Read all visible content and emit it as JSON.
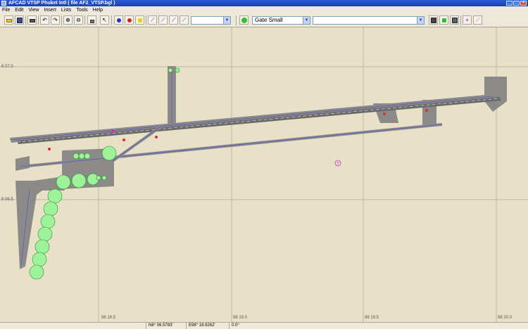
{
  "window": {
    "title": "AFCAD   VTSP   Phuket Intl   ( file AF2_VTSP.bgl )"
  },
  "menu": {
    "items": [
      "File",
      "Edit",
      "View",
      "Insert",
      "Lists",
      "Tools",
      "Help"
    ]
  },
  "toolbar": {
    "parking_type_value": "Gate Small",
    "layer_combo_value": "",
    "blank_combo_value": "",
    "description_combo_value": ""
  },
  "map": {
    "lat_labels": [
      "8 07.0",
      "8 06.5"
    ],
    "lon_labels": [
      "98 18.5",
      "98 19.0",
      "98 19.5",
      "98 20.0"
    ],
    "colors": {
      "background": "#e8e1c8",
      "grid": "#bdb7a6",
      "pavement": "#8c8a88",
      "taxiway_line": "#4a4ad8",
      "runway": "#6a6a6a",
      "parking": "#9ef29a",
      "hold_short": "#d83030"
    },
    "tower_icon_label": "T"
  },
  "status": {
    "latitude": "N8° 06.5783'",
    "longitude": "E98° 18.9262'",
    "heading": "0.0°"
  }
}
